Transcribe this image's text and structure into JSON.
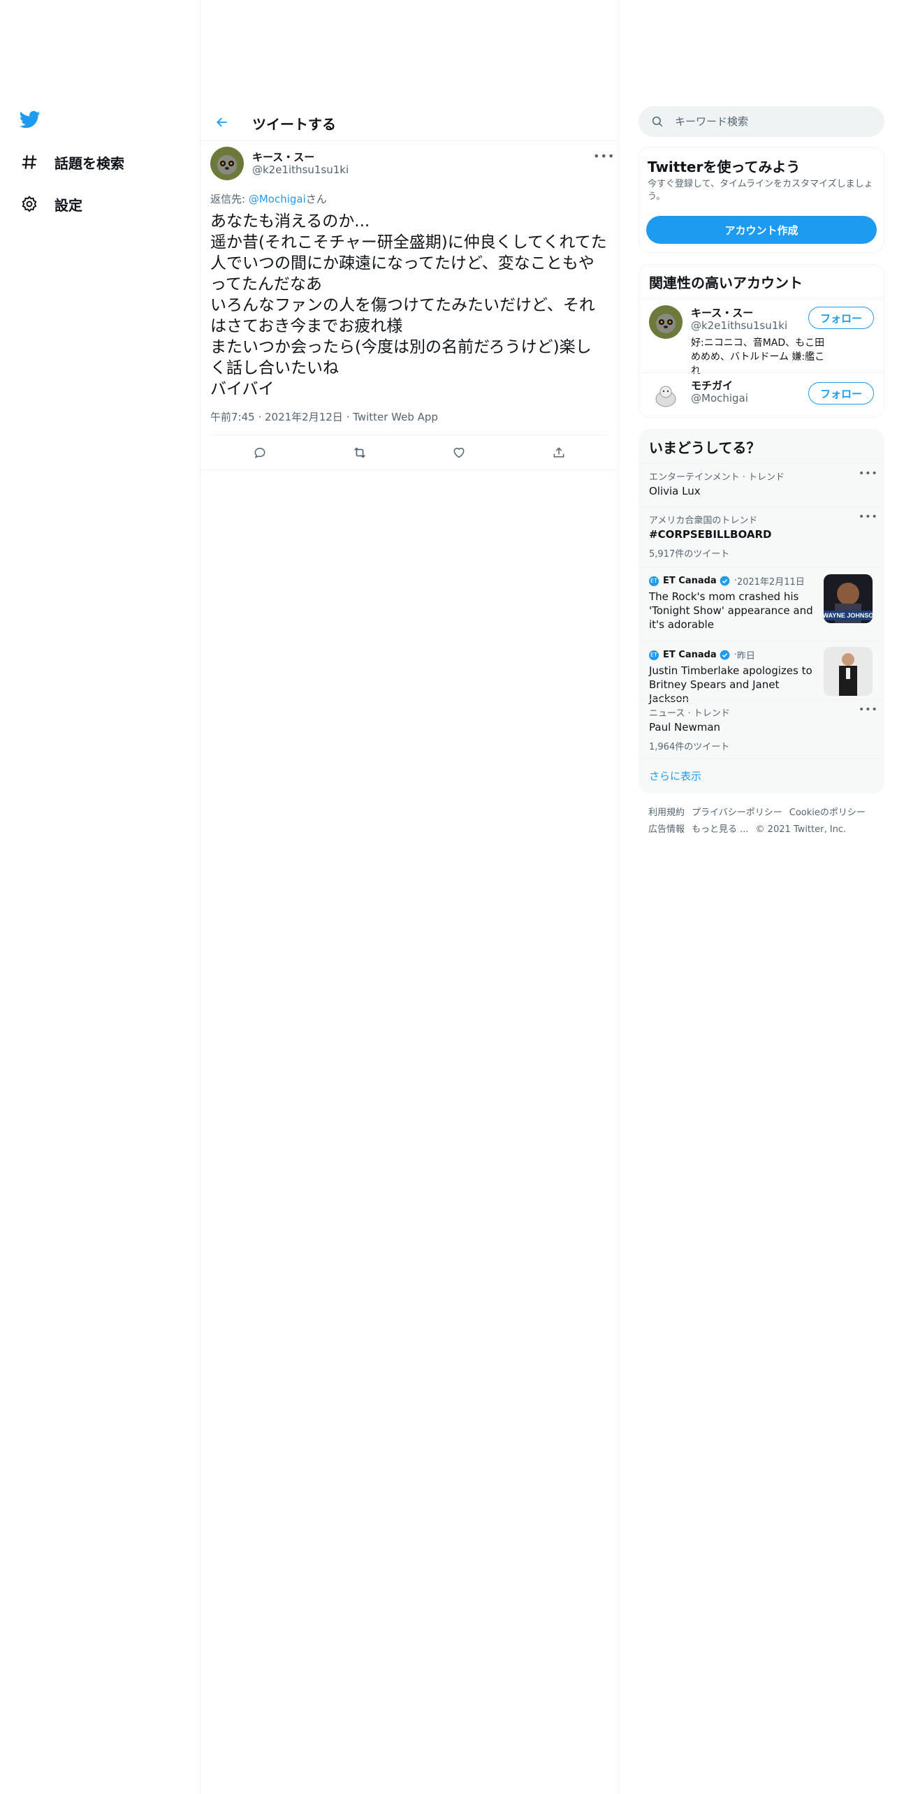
{
  "nav": {
    "items": [
      {
        "label": "話題を検索",
        "icon": "hashtag-icon"
      },
      {
        "label": "設定",
        "icon": "gear-icon"
      }
    ]
  },
  "header": {
    "title": "ツイートする"
  },
  "tweet": {
    "name": "キース・スー",
    "handle": "@k2e1ithsu1su1ki",
    "reply_prefix": "返信先: ",
    "reply_mention": "@Mochigai",
    "reply_suffix": "さん",
    "text": "あなたも消えるのか...\n遥か昔(それこそチャー研全盛期)に仲良くしてくれてた人でいつの間にか疎遠になってたけど、変なこともやってたんだなあ\nいろんなファンの人を傷つけてたみたいだけど、それはさておき今までお疲れ様\nまたいつか会ったら(今度は別の名前だろうけど)楽しく話し合いたいね\nバイバイ",
    "time": "午前7:45",
    "date": "2021年2月12日",
    "client": "Twitter Web App",
    "sep": " · "
  },
  "search": {
    "placeholder": "キーワード検索"
  },
  "signup": {
    "title": "Twitterを使ってみよう",
    "description": "今すぐ登録して、タイムラインをカスタマイズしましょう。",
    "button": "アカウント作成"
  },
  "related": {
    "title": "関連性の高いアカウント",
    "follow_label": "フォロー",
    "accounts": [
      {
        "name": "キース・スー",
        "handle": "@k2e1ithsu1su1ki",
        "bio": "好:ニコニコ、音MAD、もこ田めめめ、バトルドーム 嫌:艦これ"
      },
      {
        "name": "モチガイ",
        "handle": "@Mochigai",
        "bio": ""
      }
    ]
  },
  "trends": {
    "title": "いまどうしてる？",
    "items": [
      {
        "context": "エンターテインメント · トレンド",
        "title": "Olivia Lux"
      },
      {
        "context": "アメリカ合衆国のトレンド",
        "title": "#CORPSEBILLBOARD",
        "count": "5,917件のツイート"
      },
      {
        "context": "ニュース · トレンド",
        "title": "Paul Newman",
        "count": "1,964件のツイート"
      }
    ],
    "news": [
      {
        "source": "ET Canada",
        "when": "2021年2月11日",
        "headline": "The Rock's mom crashed his 'Tonight Show' appearance and it's adorable",
        "thumb_text": "WAYNE JOHNSO"
      },
      {
        "source": "ET Canada",
        "when": "昨日",
        "headline": "Justin Timberlake apologizes to Britney Spears and Janet Jackson"
      }
    ],
    "dot": " · ",
    "show_more": "さらに表示"
  },
  "footer": {
    "links": [
      "利用規約",
      "プライバシーポリシー",
      "Cookieのポリシー",
      "広告情報",
      "もっと見る ..."
    ],
    "copyright": "© 2021 Twitter, Inc."
  },
  "colors": {
    "accent": "#1d9bf0",
    "secondary_text": "#536471",
    "border": "#eff3f4"
  }
}
